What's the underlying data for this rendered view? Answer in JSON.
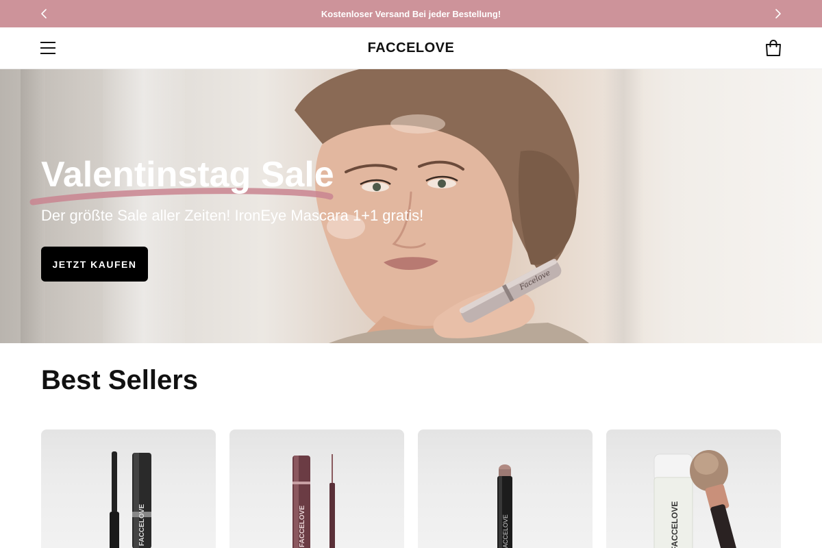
{
  "announcement": {
    "text": "Kostenloser Versand Bei jeder Bestellung!"
  },
  "header": {
    "logo": "FACCELOVE",
    "menu_icon": "hamburger-menu-icon",
    "cart_icon": "shopping-bag-icon"
  },
  "hero": {
    "title": "Valentinstag Sale",
    "subtitle": "Der größte Sale aller Zeiten! IronEye Mascara 1+1 gratis!",
    "cta_label": "JETZT KAUFEN",
    "mascara_label": "Facelove"
  },
  "best_sellers": {
    "title": "Best Sellers",
    "products": [
      {
        "brand_label": "FACCELOVE"
      },
      {
        "brand_label": "FACCELOVE"
      },
      {
        "brand_label": "FACCELOVE"
      },
      {
        "brand_label": "FACCELOVE"
      }
    ]
  },
  "colors": {
    "announcement_bg": "#cd939a",
    "underline": "#c98590",
    "cta_bg": "#000000"
  }
}
